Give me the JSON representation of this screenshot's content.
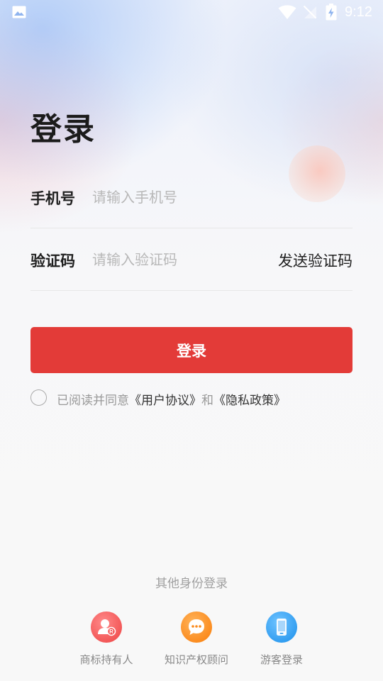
{
  "status_bar": {
    "time": "9:12",
    "icons": [
      "photo-icon",
      "wifi-icon",
      "no-signal-icon",
      "battery-charging-icon"
    ]
  },
  "page": {
    "title": "登录"
  },
  "form": {
    "phone": {
      "label": "手机号",
      "placeholder": "请输入手机号",
      "value": ""
    },
    "code": {
      "label": "验证码",
      "placeholder": "请输入验证码",
      "value": "",
      "send_label": "发送验证码"
    },
    "submit_label": "登录"
  },
  "agreement": {
    "prefix": "已阅读并同意",
    "user_agreement": "《用户协议》",
    "conjunction": "和",
    "privacy_policy": "《隐私政策》",
    "checked": false
  },
  "other_login": {
    "title": "其他身份登录",
    "methods": [
      {
        "label": "商标持有人",
        "icon": "trademark-holder-icon",
        "color": "#f25454"
      },
      {
        "label": "知识产权顾问",
        "icon": "chat-bubble-icon",
        "color": "#fb8a1c"
      },
      {
        "label": "游客登录",
        "icon": "phone-icon",
        "color": "#2f9cf0"
      }
    ]
  },
  "colors": {
    "primary": "#e33b38",
    "placeholder": "#b8b8b8",
    "link": "#333333"
  }
}
